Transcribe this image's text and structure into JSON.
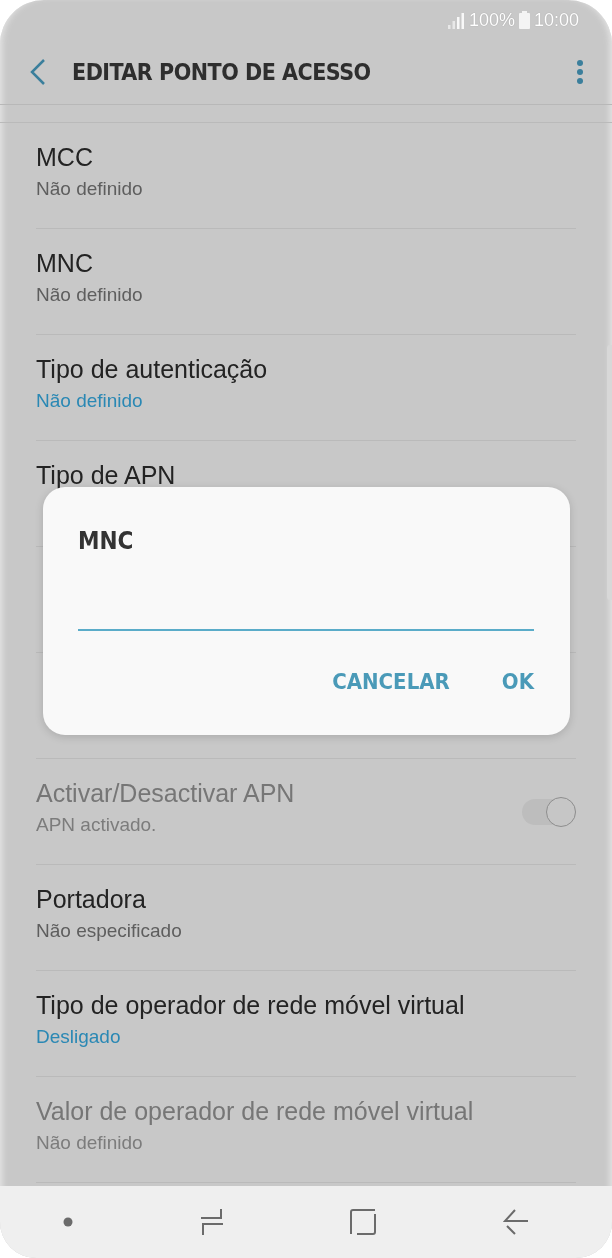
{
  "status_bar": {
    "battery": "100%",
    "time": "10:00"
  },
  "app_bar": {
    "title": "EDITAR PONTO DE ACESSO"
  },
  "settings": [
    {
      "kind": "plain",
      "title": "MCC",
      "value": "Não definido",
      "accent": false,
      "disabled": false
    },
    {
      "kind": "plain",
      "title": "MNC",
      "value": "Não definido",
      "accent": false,
      "disabled": false
    },
    {
      "kind": "plain",
      "title": "Tipo de autenticação",
      "value": "Não definido",
      "accent": true,
      "disabled": false
    },
    {
      "kind": "plain",
      "title": "Tipo de APN",
      "disabled": false
    },
    {
      "kind": "covered"
    },
    {
      "kind": "covered"
    },
    {
      "kind": "toggle",
      "title": "Activar/Desactivar APN",
      "value": "APN activado.",
      "accent": false,
      "disabled": true,
      "on": true
    },
    {
      "kind": "plain",
      "title": "Portadora",
      "value": "Não especificado",
      "accent": false,
      "disabled": false
    },
    {
      "kind": "plain",
      "title": "Tipo de operador de rede móvel virtual",
      "value": "Desligado",
      "accent": true,
      "disabled": false
    },
    {
      "kind": "plain",
      "title": "Valor de operador de rede móvel virtual",
      "value": "Não definido",
      "accent": false,
      "disabled": true
    }
  ],
  "dialog": {
    "title": "MNC",
    "buttons": [
      "CANCELAR",
      "OK"
    ]
  }
}
